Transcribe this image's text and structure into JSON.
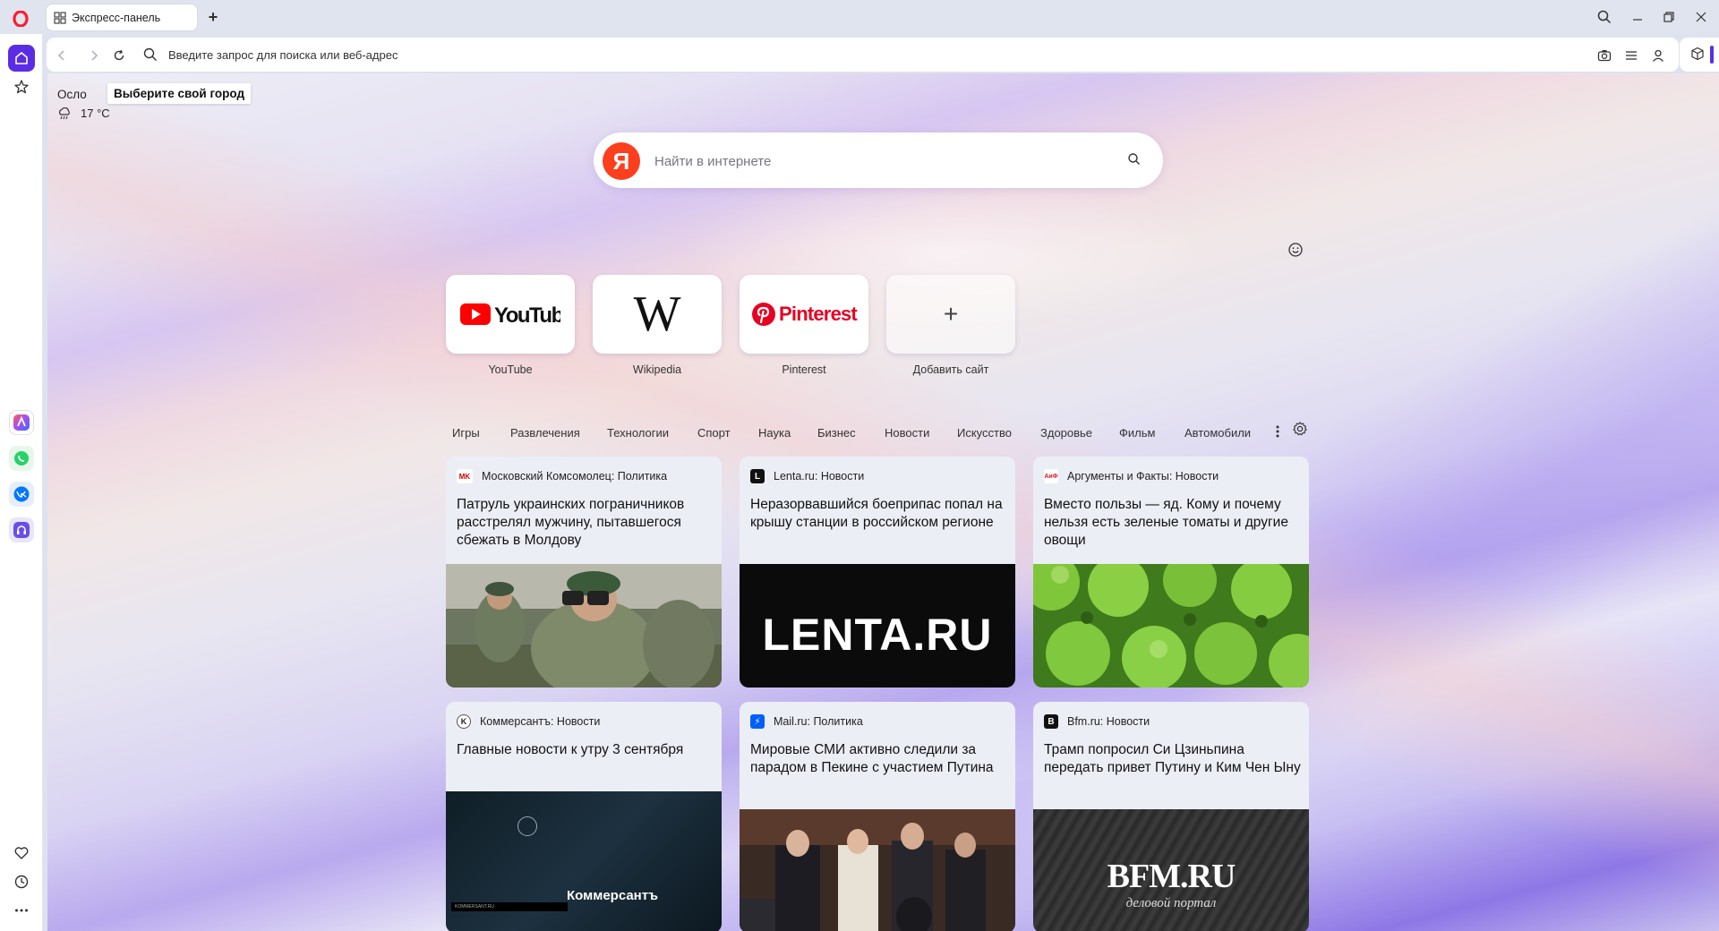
{
  "browser": {
    "tab_title": "Экспресс-панель",
    "address_placeholder": "Введите запрос для поиска или веб-адрес"
  },
  "weather": {
    "city": "Осло",
    "tooltip": "Выберите свой город",
    "temperature": "17 °C"
  },
  "search": {
    "logo": "Я",
    "placeholder": "Найти в интернете"
  },
  "speed_dial": [
    {
      "label": "YouTube",
      "icon": "youtube-logo"
    },
    {
      "label": "Wikipedia",
      "icon": "wikipedia-logo",
      "logo_text": "W"
    },
    {
      "label": "Pinterest",
      "icon": "pinterest-logo",
      "logo_text": "Pinterest"
    },
    {
      "label": "Добавить сайт",
      "icon": "plus-icon",
      "logo_text": "+"
    }
  ],
  "youtube_logo_text": "YouTube",
  "news_categories": [
    "Игры",
    "Развлечения",
    "Технологии",
    "Спорт",
    "Наука",
    "Бизнес",
    "Новости",
    "Искусство",
    "Здоровье",
    "Фильм",
    "Автомобили"
  ],
  "news": [
    {
      "source": "Московский Комсомолец: Политика",
      "source_icon": "MK",
      "title": "Патруль украинских пограничников расстрелял мужчину, пытавшегося сбежать в Молдову"
    },
    {
      "source": "Lenta.ru: Новости",
      "source_icon": "L",
      "title": "Неразорвавшийся боеприпас попал на крышу станции в российском регионе",
      "image_text": "LENTA.RU"
    },
    {
      "source": "Аргументы и Факты: Новости",
      "source_icon": "АиФ",
      "title": "Вместо пользы — яд. Кому и почему нельзя есть зеленые томаты и другие овощи"
    },
    {
      "source": "Коммерсантъ: Новости",
      "source_icon": "K",
      "title": "Главные новости к утру 3 сентября",
      "image_text": "Коммерсантъ",
      "image_small": "KOMMERSANT.RU"
    },
    {
      "source": "Mail.ru: Политика",
      "source_icon": "⚡",
      "title": "Мировые СМИ активно следили за парадом в Пекине с участием Путина"
    },
    {
      "source": "Bfm.ru: Новости",
      "source_icon": "B",
      "title": "Трамп попросил Си Цзиньпина передать привет Путину и Ким Чен Ыну",
      "image_text": "BFM.RU",
      "image_sub": "деловой портал"
    }
  ],
  "colors": {
    "accent": "#5a2de4",
    "opera_red": "#ff1b2d",
    "yandex_red": "#fc3f1d",
    "youtube_red": "#ff0000",
    "pinterest_red": "#e60023"
  }
}
